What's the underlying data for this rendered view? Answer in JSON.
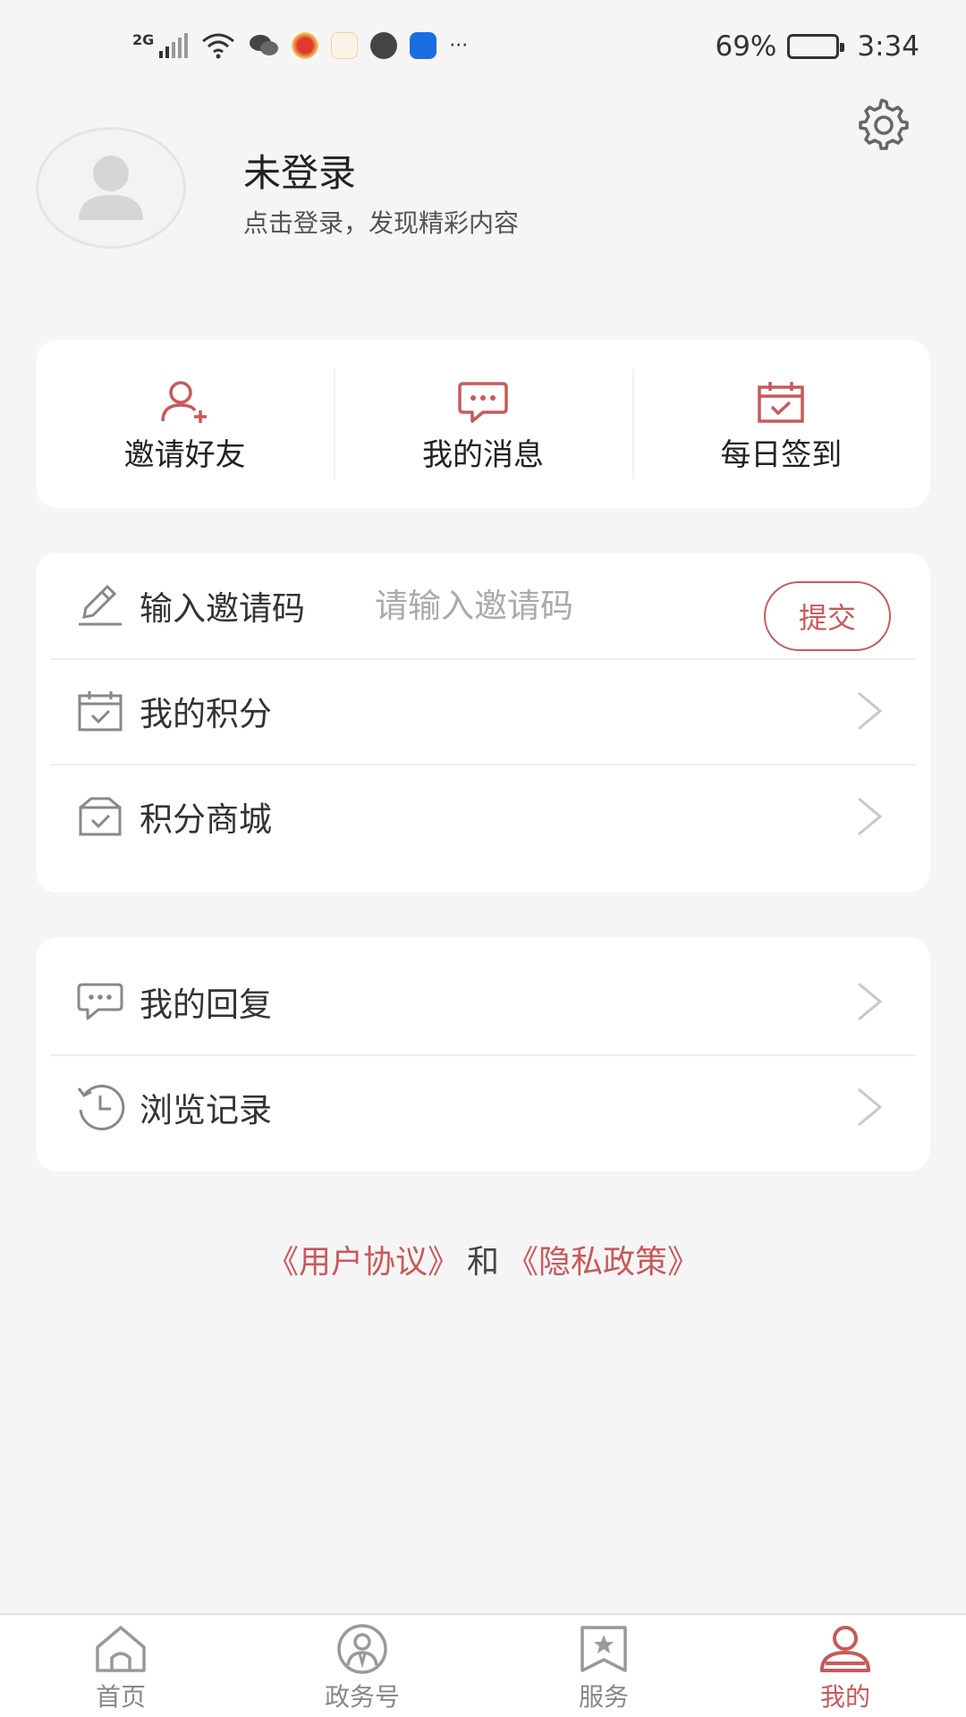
{
  "status_bar": {
    "network": "2G",
    "battery_percent": "69%",
    "battery_level": 0.69,
    "time": "3:34",
    "more": "···"
  },
  "profile": {
    "name": "未登录",
    "subtitle": "点击登录，发现精彩内容"
  },
  "quick_actions": [
    {
      "label": "邀请好友",
      "icon": "add-user-icon"
    },
    {
      "label": "我的消息",
      "icon": "message-icon"
    },
    {
      "label": "每日签到",
      "icon": "calendar-check-icon"
    }
  ],
  "invite": {
    "label": "输入邀请码",
    "placeholder": "请输入邀请码",
    "submit_label": "提交"
  },
  "points_list": [
    {
      "label": "我的积分",
      "icon": "calendar-check-icon"
    },
    {
      "label": "积分商城",
      "icon": "gift-box-icon"
    }
  ],
  "activity_list": [
    {
      "label": "我的回复",
      "icon": "chat-bubble-icon"
    },
    {
      "label": "浏览记录",
      "icon": "history-clock-icon"
    }
  ],
  "agreement": {
    "user_agreement": "《用户协议》",
    "and": "和",
    "privacy_policy": "《隐私政策》"
  },
  "bottom_nav": [
    {
      "label": "首页",
      "icon": "home-icon"
    },
    {
      "label": "政务号",
      "icon": "gov-account-icon"
    },
    {
      "label": "服务",
      "icon": "service-star-icon"
    },
    {
      "label": "我的",
      "icon": "profile-icon",
      "active": true
    }
  ],
  "colors": {
    "accent": "#c9595b",
    "background": "#f5f5f5",
    "card": "#ffffff"
  }
}
